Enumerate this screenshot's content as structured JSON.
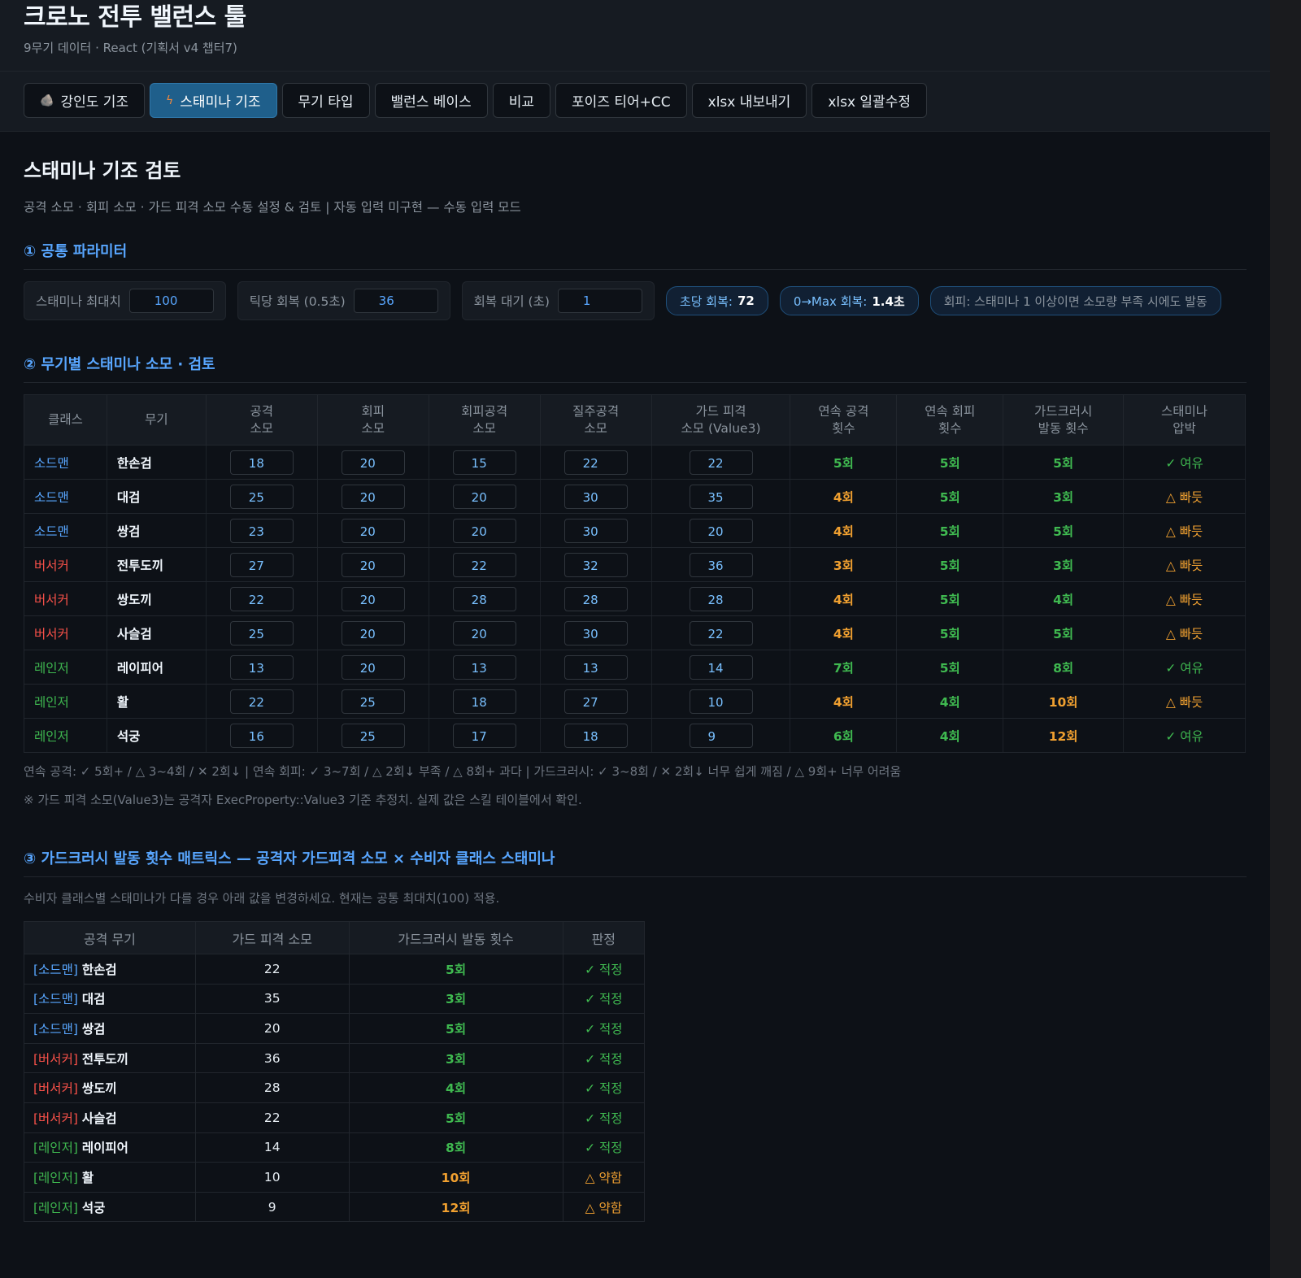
{
  "app": {
    "title": "크로노 전투 밸런스 툴",
    "subtitle": "9무기 데이터 · React (기획서 v4 챕터7)"
  },
  "tabs": [
    {
      "label": "강인도 기조",
      "icon": "rock-icon",
      "icon_glyph": "🪨",
      "active": false
    },
    {
      "label": "스태미나 기조",
      "icon": "bolt-icon",
      "icon_glyph": "ϟ",
      "active": true
    },
    {
      "label": "무기 타입",
      "active": false
    },
    {
      "label": "밸런스 베이스",
      "active": false
    },
    {
      "label": "비교",
      "active": false
    },
    {
      "label": "포이즈 티어+CC",
      "active": false
    },
    {
      "label": "xlsx 내보내기",
      "active": false
    },
    {
      "label": "xlsx 일괄수정",
      "active": false
    }
  ],
  "page": {
    "title": "스태미나 기조 검토",
    "description": "공격 소모 · 회피 소모 · 가드 피격 소모 수동 설정 & 검토 | 자동 입력 미구현 — 수동 입력 모드"
  },
  "section1": {
    "title": "① 공통 파라미터",
    "params": [
      {
        "label": "스태미나 최대치",
        "value": "100"
      },
      {
        "label": "틱당 회복 (0.5초)",
        "value": "36"
      },
      {
        "label": "회복 대기 (초)",
        "value": "1"
      }
    ],
    "pills": [
      {
        "label": "초당 회복:",
        "value": "72"
      },
      {
        "label": "0→Max 회복:",
        "value": "1.4초"
      }
    ],
    "dodge_note": "회피: 스태미나 1 이상이면 소모량 부족 시에도 발동"
  },
  "section2": {
    "title": "② 무기별 스태미나 소모 · 검토",
    "headers": [
      [
        "클래스"
      ],
      [
        "무기"
      ],
      [
        "공격",
        "소모"
      ],
      [
        "회피",
        "소모"
      ],
      [
        "회피공격",
        "소모"
      ],
      [
        "질주공격",
        "소모"
      ],
      [
        "가드 피격",
        "소모 (Value3)"
      ],
      [
        "연속 공격",
        "횟수"
      ],
      [
        "연속 회피",
        "횟수"
      ],
      [
        "가드크러시",
        "발동 횟수"
      ],
      [
        "스태미나",
        "압박"
      ]
    ],
    "rows": [
      {
        "cls": "소드맨",
        "cls_key": "sword",
        "weapon": "한손검",
        "atk": "18",
        "dodge": "20",
        "dodge_atk": "15",
        "sprint_atk": "22",
        "guard": "22",
        "combo_atk": "5회",
        "combo_atk_c": "g",
        "combo_dodge": "5회",
        "combo_dodge_c": "g",
        "crush": "5회",
        "crush_c": "g",
        "pressure": "✓ 여유",
        "pressure_c": "g"
      },
      {
        "cls": "소드맨",
        "cls_key": "sword",
        "weapon": "대검",
        "atk": "25",
        "dodge": "20",
        "dodge_atk": "20",
        "sprint_atk": "30",
        "guard": "35",
        "combo_atk": "4회",
        "combo_atk_c": "o",
        "combo_dodge": "5회",
        "combo_dodge_c": "g",
        "crush": "3회",
        "crush_c": "g",
        "pressure": "△ 빠듯",
        "pressure_c": "o"
      },
      {
        "cls": "소드맨",
        "cls_key": "sword",
        "weapon": "쌍검",
        "atk": "23",
        "dodge": "20",
        "dodge_atk": "20",
        "sprint_atk": "30",
        "guard": "20",
        "combo_atk": "4회",
        "combo_atk_c": "o",
        "combo_dodge": "5회",
        "combo_dodge_c": "g",
        "crush": "5회",
        "crush_c": "g",
        "pressure": "△ 빠듯",
        "pressure_c": "o"
      },
      {
        "cls": "버서커",
        "cls_key": "berserk",
        "weapon": "전투도끼",
        "atk": "27",
        "dodge": "20",
        "dodge_atk": "22",
        "sprint_atk": "32",
        "guard": "36",
        "combo_atk": "3회",
        "combo_atk_c": "o",
        "combo_dodge": "5회",
        "combo_dodge_c": "g",
        "crush": "3회",
        "crush_c": "g",
        "pressure": "△ 빠듯",
        "pressure_c": "o"
      },
      {
        "cls": "버서커",
        "cls_key": "berserk",
        "weapon": "쌍도끼",
        "atk": "22",
        "dodge": "20",
        "dodge_atk": "28",
        "sprint_atk": "28",
        "guard": "28",
        "combo_atk": "4회",
        "combo_atk_c": "o",
        "combo_dodge": "5회",
        "combo_dodge_c": "g",
        "crush": "4회",
        "crush_c": "g",
        "pressure": "△ 빠듯",
        "pressure_c": "o"
      },
      {
        "cls": "버서커",
        "cls_key": "berserk",
        "weapon": "사슬검",
        "atk": "25",
        "dodge": "20",
        "dodge_atk": "20",
        "sprint_atk": "30",
        "guard": "22",
        "combo_atk": "4회",
        "combo_atk_c": "o",
        "combo_dodge": "5회",
        "combo_dodge_c": "g",
        "crush": "5회",
        "crush_c": "g",
        "pressure": "△ 빠듯",
        "pressure_c": "o"
      },
      {
        "cls": "레인저",
        "cls_key": "ranger",
        "weapon": "레이피어",
        "atk": "13",
        "dodge": "20",
        "dodge_atk": "13",
        "sprint_atk": "13",
        "guard": "14",
        "combo_atk": "7회",
        "combo_atk_c": "g",
        "combo_dodge": "5회",
        "combo_dodge_c": "g",
        "crush": "8회",
        "crush_c": "g",
        "pressure": "✓ 여유",
        "pressure_c": "g"
      },
      {
        "cls": "레인저",
        "cls_key": "ranger",
        "weapon": "활",
        "atk": "22",
        "dodge": "25",
        "dodge_atk": "18",
        "sprint_atk": "27",
        "guard": "10",
        "combo_atk": "4회",
        "combo_atk_c": "o",
        "combo_dodge": "4회",
        "combo_dodge_c": "g",
        "crush": "10회",
        "crush_c": "o",
        "pressure": "△ 빠듯",
        "pressure_c": "o"
      },
      {
        "cls": "레인저",
        "cls_key": "ranger",
        "weapon": "석궁",
        "atk": "16",
        "dodge": "25",
        "dodge_atk": "17",
        "sprint_atk": "18",
        "guard": "9",
        "combo_atk": "6회",
        "combo_atk_c": "g",
        "combo_dodge": "4회",
        "combo_dodge_c": "g",
        "crush": "12회",
        "crush_c": "o",
        "pressure": "✓ 여유",
        "pressure_c": "g"
      }
    ],
    "legend": "연속 공격: ✓ 5회+ / △ 3~4회 / ✕ 2회↓ |  연속 회피: ✓ 3~7회 / △ 2회↓ 부족 / △ 8회+ 과다 |  가드크러시: ✓ 3~8회 / ✕ 2회↓ 너무 쉽게 깨짐 / △ 9회+ 너무 어려움",
    "footnote": "※ 가드 피격 소모(Value3)는 공격자 ExecProperty::Value3 기준 추정치. 실제 값은 스킬 테이블에서 확인."
  },
  "section3": {
    "title": "③ 가드크러시 발동 횟수 매트릭스 — 공격자 가드피격 소모 × 수비자 클래스 스태미나",
    "description": "수비자 클래스별 스태미나가 다를 경우 아래 값을 변경하세요. 현재는 공통 최대치(100) 적용.",
    "headers": [
      "공격 무기",
      "가드 피격 소모",
      "가드크러시 발동 횟수",
      "판정"
    ],
    "rows": [
      {
        "cls": "[소드맨]",
        "cls_key": "sword",
        "weapon": "한손검",
        "guard": "22",
        "count": "5회",
        "count_c": "g",
        "verdict": "✓ 적정",
        "verdict_c": "g"
      },
      {
        "cls": "[소드맨]",
        "cls_key": "sword",
        "weapon": "대검",
        "guard": "35",
        "count": "3회",
        "count_c": "g",
        "verdict": "✓ 적정",
        "verdict_c": "g"
      },
      {
        "cls": "[소드맨]",
        "cls_key": "sword",
        "weapon": "쌍검",
        "guard": "20",
        "count": "5회",
        "count_c": "g",
        "verdict": "✓ 적정",
        "verdict_c": "g"
      },
      {
        "cls": "[버서커]",
        "cls_key": "berserk",
        "weapon": "전투도끼",
        "guard": "36",
        "count": "3회",
        "count_c": "g",
        "verdict": "✓ 적정",
        "verdict_c": "g"
      },
      {
        "cls": "[버서커]",
        "cls_key": "berserk",
        "weapon": "쌍도끼",
        "guard": "28",
        "count": "4회",
        "count_c": "g",
        "verdict": "✓ 적정",
        "verdict_c": "g"
      },
      {
        "cls": "[버서커]",
        "cls_key": "berserk",
        "weapon": "사슬검",
        "guard": "22",
        "count": "5회",
        "count_c": "g",
        "verdict": "✓ 적정",
        "verdict_c": "g"
      },
      {
        "cls": "[레인저]",
        "cls_key": "ranger",
        "weapon": "레이피어",
        "guard": "14",
        "count": "8회",
        "count_c": "g",
        "verdict": "✓ 적정",
        "verdict_c": "g"
      },
      {
        "cls": "[레인저]",
        "cls_key": "ranger",
        "weapon": "활",
        "guard": "10",
        "count": "10회",
        "count_c": "o",
        "verdict": "△ 약함",
        "verdict_c": "o"
      },
      {
        "cls": "[레인저]",
        "cls_key": "ranger",
        "weapon": "석궁",
        "guard": "9",
        "count": "12회",
        "count_c": "o",
        "verdict": "△ 약함",
        "verdict_c": "o"
      }
    ]
  },
  "colors": {
    "background": "#0d1117",
    "accent": "#58a6ff",
    "active_tab": "#1f5f8b",
    "good": "#3fb950",
    "warn": "#f0a030",
    "sword": "#58a6ff",
    "berserker": "#f85149",
    "ranger": "#3fb950"
  }
}
